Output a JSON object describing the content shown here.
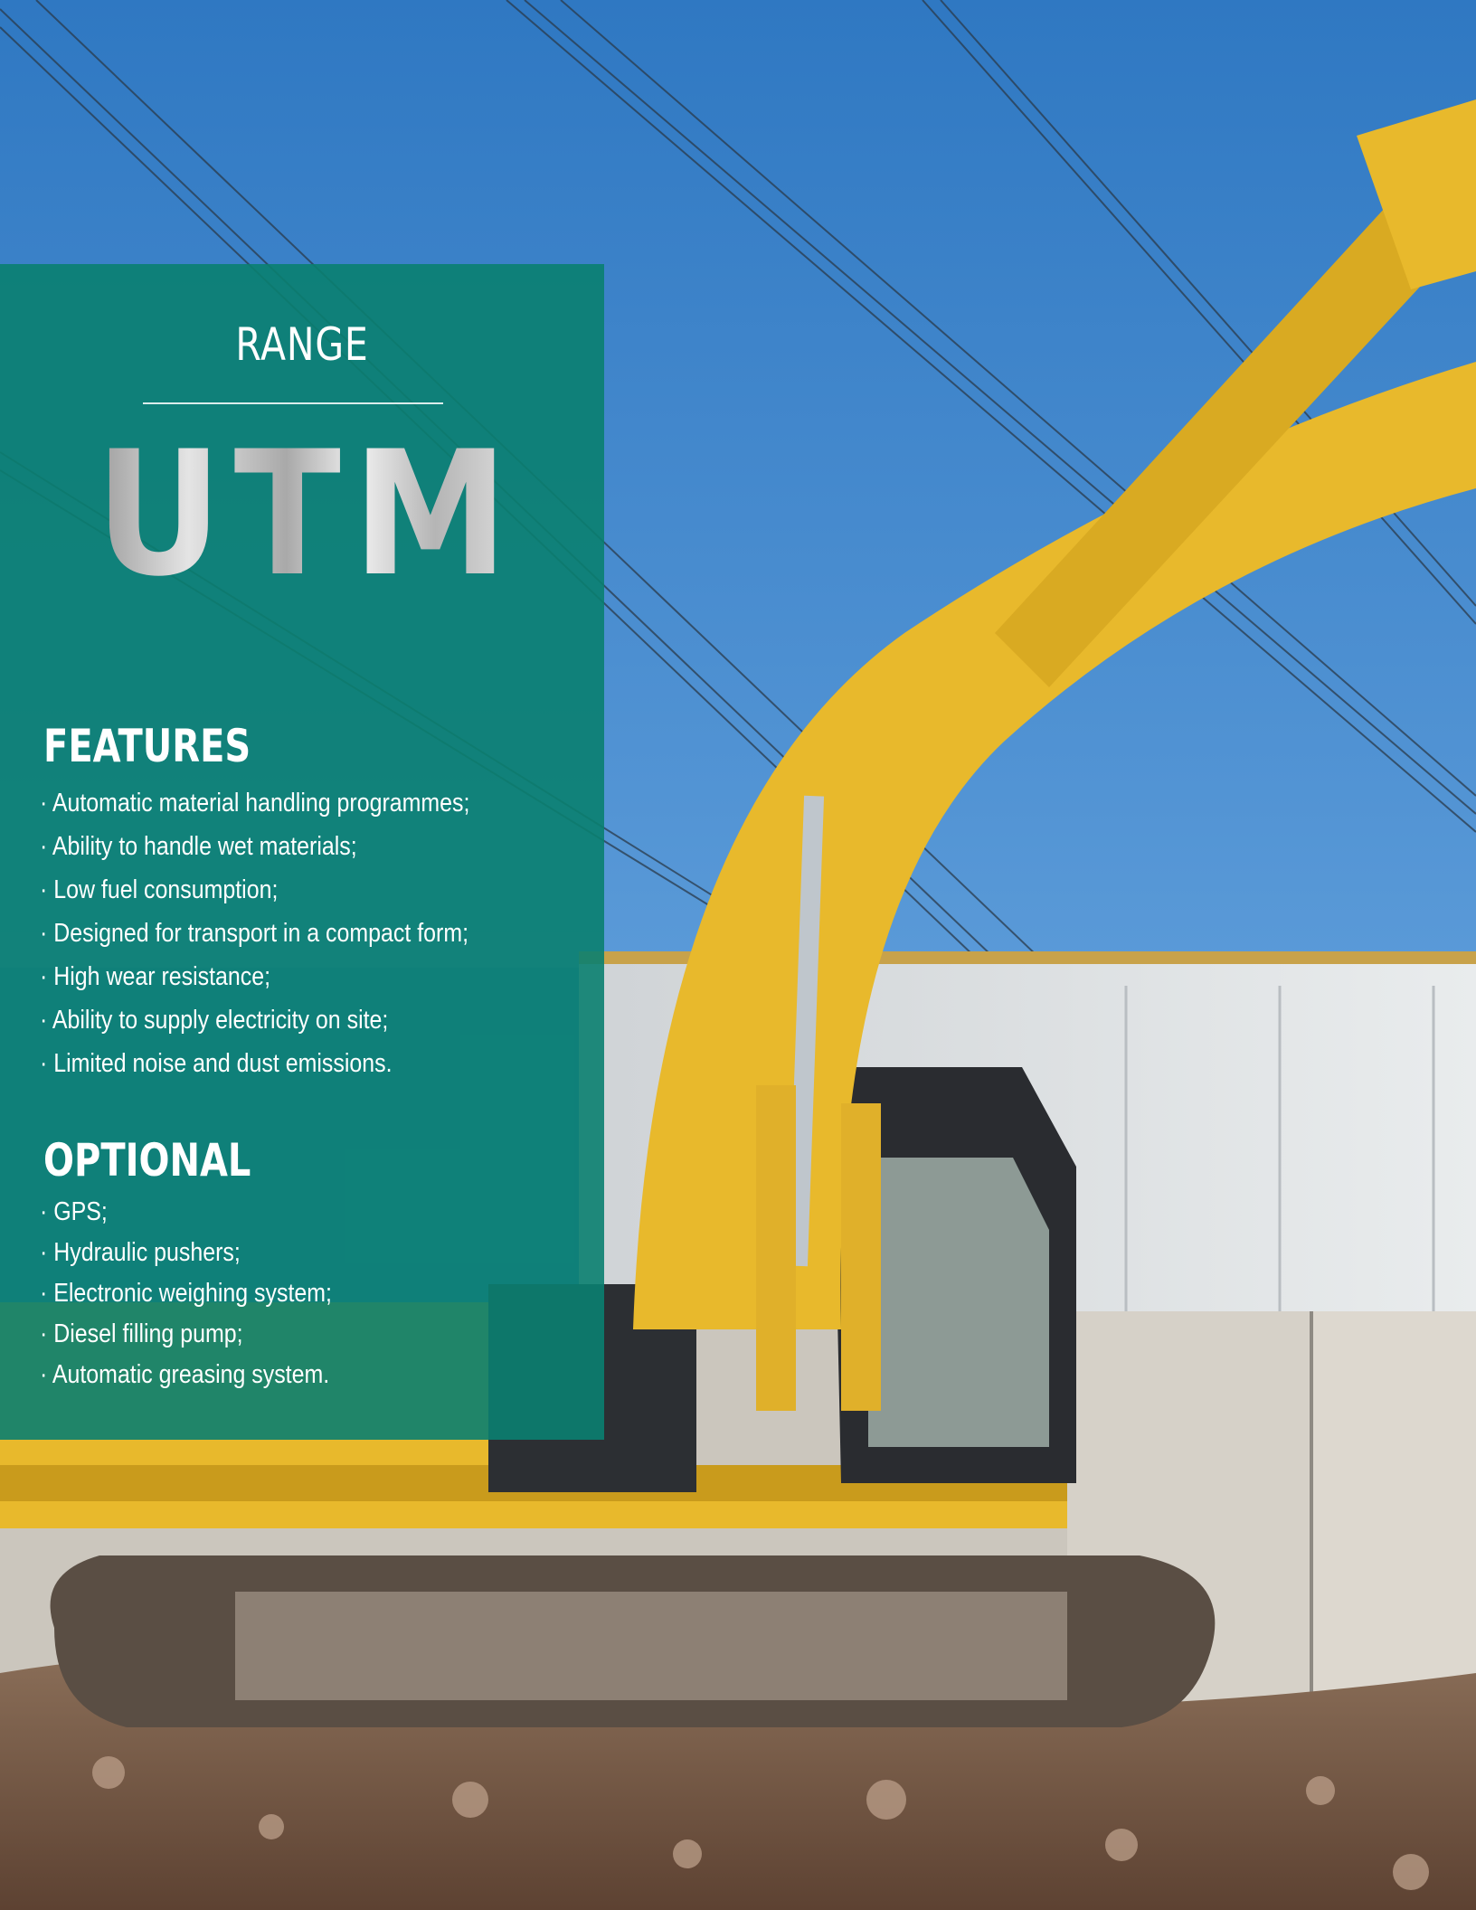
{
  "range": {
    "heading": "RANGE",
    "model": "UTM"
  },
  "features": {
    "heading": "FEATURES",
    "items": [
      "· Automatic material handling programmes;",
      "· Ability to handle wet materials;",
      "· Low fuel consumption;",
      "· Designed for transport in a compact form;",
      "· High wear resistance;",
      "· Ability to supply electricity on site;",
      "· Limited noise and dust emissions."
    ]
  },
  "optional": {
    "heading": "OPTIONAL",
    "items": [
      "· GPS;",
      "· Hydraulic pushers;",
      "· Electronic weighing system;",
      "· Diesel filling pump;",
      "· Automatic greasing system."
    ]
  },
  "colors": {
    "panel": "#0a8070",
    "sky": "#3d86cc",
    "excavator": "#e8b92c",
    "soil": "#7a5a42"
  }
}
